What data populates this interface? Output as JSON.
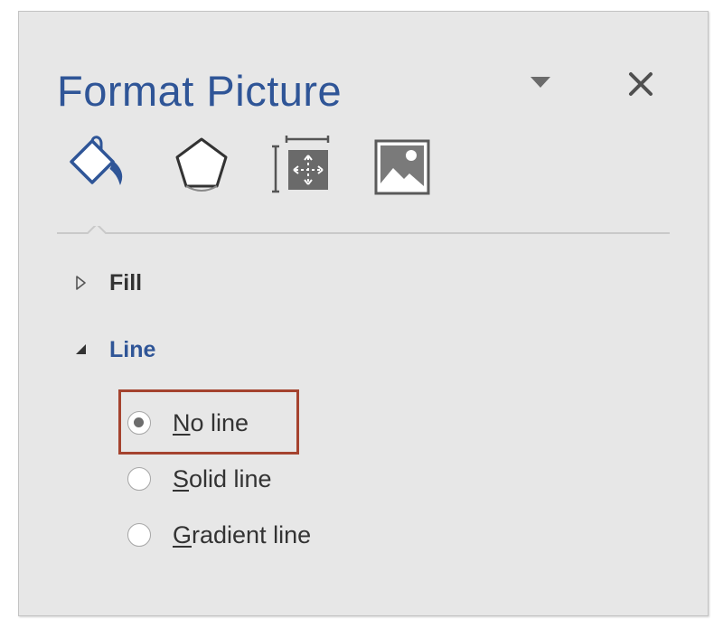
{
  "pane": {
    "title": "Format Picture",
    "menu_icon": "triangle-down-icon",
    "close_icon": "close-icon"
  },
  "tabs": [
    {
      "icon": "fill-and-line-icon",
      "selected": true
    },
    {
      "icon": "effects-pentagon-icon",
      "selected": false
    },
    {
      "icon": "size-and-properties-icon",
      "selected": false
    },
    {
      "icon": "picture-icon",
      "selected": false
    }
  ],
  "sections": {
    "fill": {
      "label": "Fill",
      "expanded": false
    },
    "line": {
      "label": "Line",
      "expanded": true
    }
  },
  "line_options": [
    {
      "mnemonic": "N",
      "rest": "o line",
      "checked": true
    },
    {
      "mnemonic": "S",
      "rest": "olid line",
      "checked": false
    },
    {
      "mnemonic": "G",
      "rest": "radient line",
      "checked": false
    }
  ],
  "colors": {
    "accent": "#2f5597",
    "highlight_border": "#a5432f",
    "pane_background": "#e7e7e7"
  }
}
